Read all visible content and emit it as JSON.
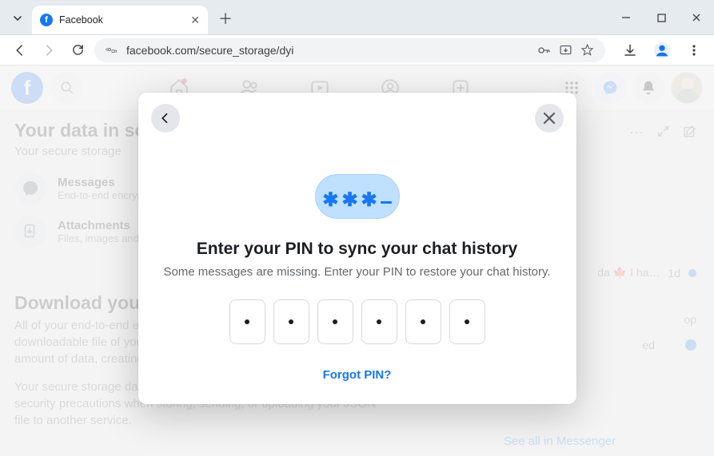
{
  "browser": {
    "tab_title": "Facebook",
    "url": "facebook.com/secure_storage/dyi"
  },
  "page": {
    "heading": "Your data in secure storage",
    "sub": "Your secure storage",
    "row_messages_title": "Messages",
    "row_messages_sub": "End-to-end encrypted messages",
    "row_attachments_title": "Attachments",
    "row_attachments_sub": "Files, images and other attachments",
    "download_heading": "Download your information",
    "download_p1": "All of your end-to-end encrypted data will be compiled into a downloadable file of your secure storage data. Depending on the amount of data, creating a file may take several hours.",
    "download_p2": "Your secure storage data may contain private information. Take strong security precautions when storing, sending, or uploading your JSON file to another service."
  },
  "messenger": {
    "frag1_text": "da 🍁 I ha…",
    "frag1_time": "1d",
    "frag2_text": "op",
    "frag2_unread": "ed",
    "see_all": "See all in Messenger"
  },
  "modal": {
    "title": "Enter your PIN to sync your chat history",
    "desc": "Some messages are missing. Enter your PIN to restore your chat history.",
    "forgot": "Forgot PIN?"
  }
}
